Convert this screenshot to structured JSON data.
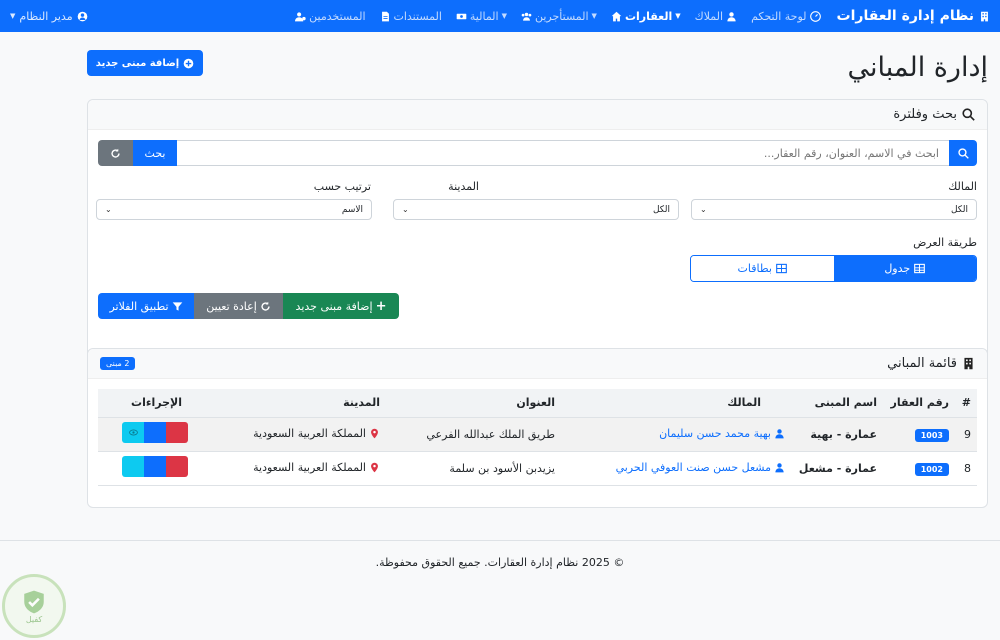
{
  "navbar": {
    "brand": "نظام إدارة العقارات",
    "links": [
      {
        "label": "لوحة التحكم",
        "icon": "dashboard-icon",
        "active": false
      },
      {
        "label": "الملاك",
        "icon": "user-icon",
        "active": false
      },
      {
        "label": "العقارات",
        "icon": "home-icon",
        "active": true
      },
      {
        "label": "المستأجرين",
        "icon": "users-icon",
        "active": false
      },
      {
        "label": "المالية",
        "icon": "money-icon",
        "active": false
      },
      {
        "label": "المستندات",
        "icon": "file-icon",
        "active": false
      },
      {
        "label": "المستخدمين",
        "icon": "users-cog-icon",
        "active": false
      }
    ],
    "user_menu": "مدير النظام"
  },
  "page": {
    "title": "إدارة المباني",
    "add_button": "إضافة مبنى جديد"
  },
  "search_card": {
    "title": "بحث وفلترة",
    "search_placeholder": "ابحث في الاسم، العنوان، رقم العقار...",
    "search_button": "بحث",
    "filters": {
      "owner": {
        "label": "المالك",
        "value": "الكل"
      },
      "city": {
        "label": "المدينة",
        "value": "الكل"
      },
      "sort": {
        "label": "ترتيب حسب",
        "value": "الاسم"
      }
    },
    "view_mode_label": "طريقة العرض",
    "view_table": "جدول",
    "view_cards": "بطاقات",
    "apply_button": "تطبيق الفلاتر",
    "reset_button": "إعادة تعيين",
    "add_button": "إضافة مبنى جديد"
  },
  "list_card": {
    "title": "قائمة المباني",
    "count_badge": "2 مبنى",
    "columns": [
      "#",
      "رقم العقار",
      "اسم المبنى",
      "المالك",
      "العنوان",
      "المدينة",
      "الإجراءات"
    ],
    "rows": [
      {
        "index": "9",
        "code": "1003",
        "name": "عمارة - بهية",
        "owner": "بهية محمد حسن سليمان",
        "address": "طريق الملك عبدالله الفرعي",
        "city": "المملكة العربية السعودية"
      },
      {
        "index": "8",
        "code": "1002",
        "name": "عمارة - مشعل",
        "owner": "مشعل حسن صنت العوفي الحربي",
        "address": "يزيدبن الأسود بن سلمة",
        "city": "المملكة العربية السعودية"
      }
    ]
  },
  "footer": {
    "text": "© 2025 نظام إدارة العقارات. جميع الحقوق محفوظة."
  },
  "watermark": {
    "text": "كفيل"
  },
  "colors": {
    "primary": "#0d6efd",
    "secondary": "#6c757d",
    "success": "#198754",
    "danger": "#dc3545",
    "info": "#0dcaf0"
  }
}
